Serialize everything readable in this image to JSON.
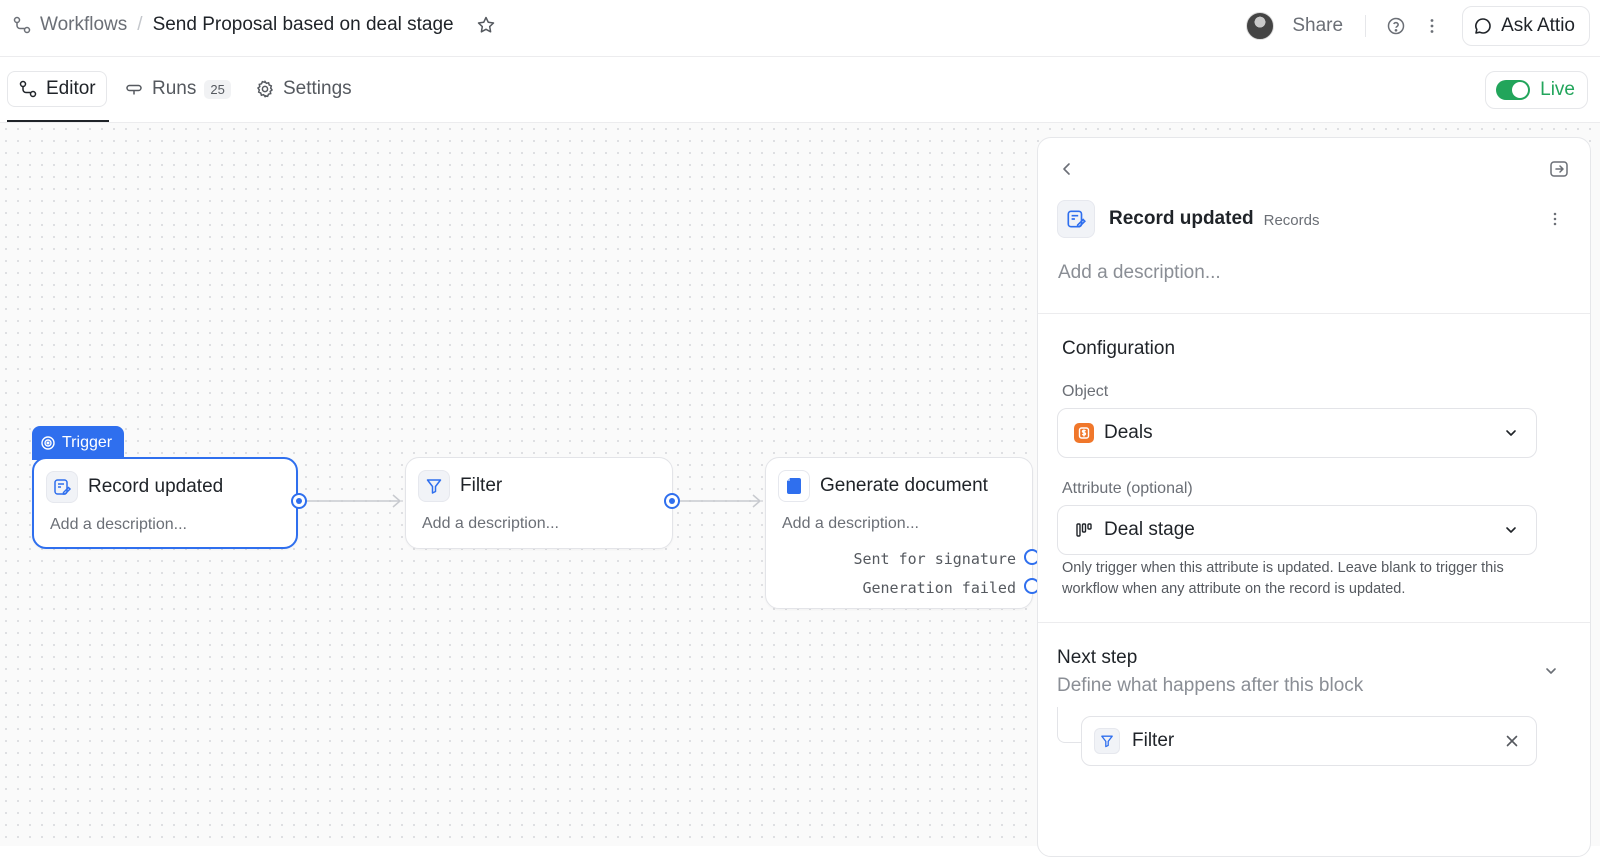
{
  "breadcrumb": {
    "root": "Workflows",
    "separator": "/",
    "title": "Send Proposal based on deal stage"
  },
  "header": {
    "share_label": "Share",
    "ask_label": "Ask Attio"
  },
  "tabs": [
    {
      "label": "Editor",
      "icon": "workflow-icon",
      "active": true
    },
    {
      "label": "Runs",
      "icon": "runs-icon",
      "count": "25"
    },
    {
      "label": "Settings",
      "icon": "gear-icon"
    }
  ],
  "live": {
    "label": "Live",
    "enabled": true,
    "color": "#22a55b"
  },
  "accent_color": "#2f6fee",
  "canvas": {
    "trigger_tag": "Trigger",
    "nodes": [
      {
        "id": "record-updated",
        "title": "Record updated",
        "description_placeholder": "Add a description...",
        "icon": "record-icon",
        "selected": true
      },
      {
        "id": "filter",
        "title": "Filter",
        "description_placeholder": "Add a description...",
        "icon": "filter-icon"
      },
      {
        "id": "generate-document",
        "title": "Generate document",
        "description_placeholder": "Add a description...",
        "icon": "document-icon",
        "outcomes": [
          "Sent for signature",
          "Generation failed"
        ]
      }
    ]
  },
  "panel": {
    "title": "Record updated",
    "subtitle": "Records",
    "description_placeholder": "Add a description...",
    "configuration_title": "Configuration",
    "object_label": "Object",
    "object_value": "Deals",
    "attribute_label": "Attribute",
    "attribute_optional": "(optional)",
    "attribute_value": "Deal stage",
    "attribute_help": "Only trigger when this attribute is updated. Leave blank to trigger this workflow when any attribute on the record is updated.",
    "next_step_title": "Next step",
    "next_step_subtitle": "Define what happens after this block",
    "next_step_value": "Filter"
  }
}
